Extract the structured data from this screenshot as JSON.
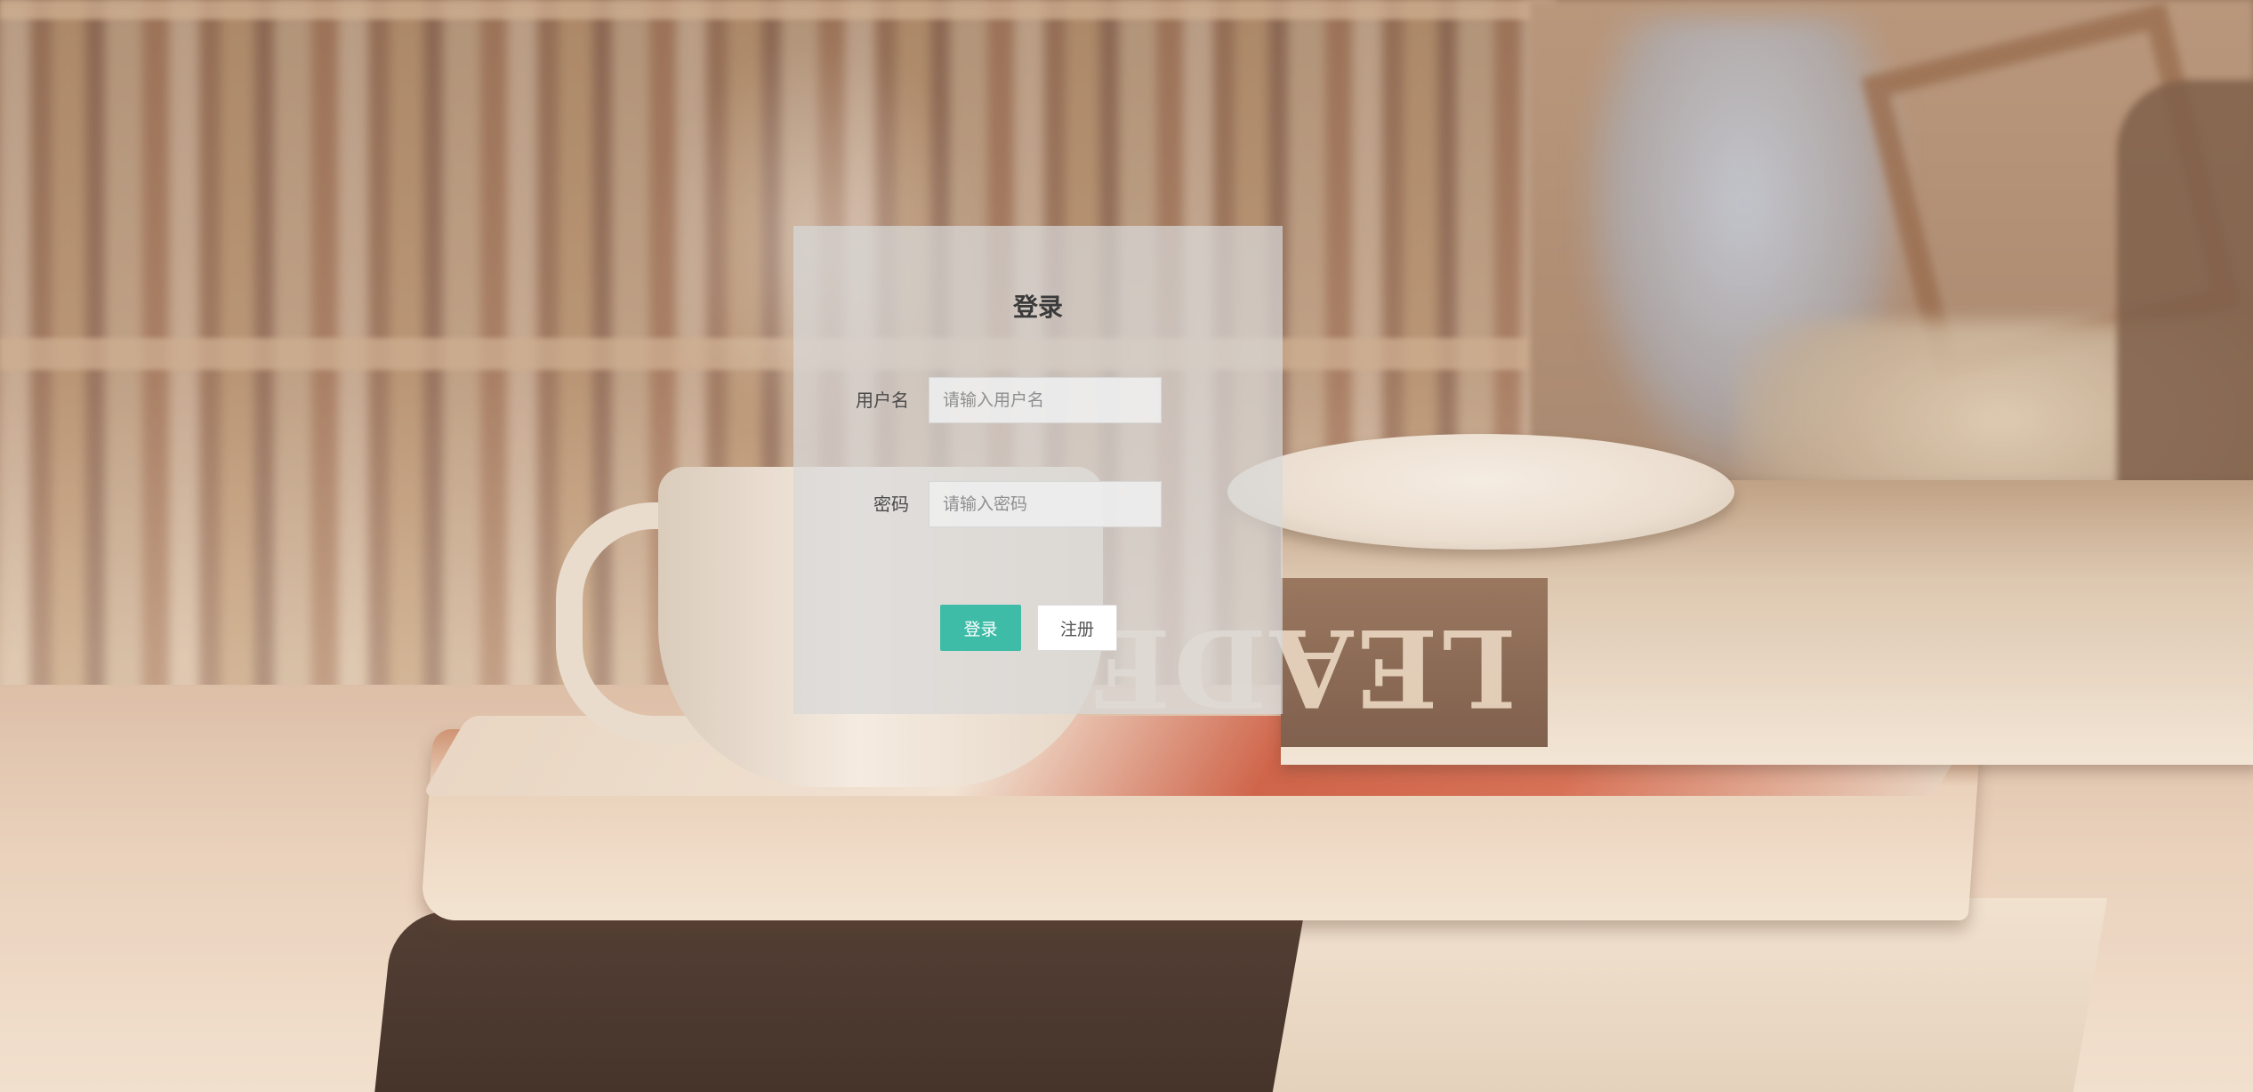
{
  "login": {
    "title": "登录",
    "username_label": "用户名",
    "username_placeholder": "请输入用户名",
    "username_value": "",
    "password_label": "密码",
    "password_placeholder": "请输入密码",
    "password_value": "",
    "login_button": "登录",
    "register_button": "注册"
  },
  "background": {
    "book_spine_text": "LEADERSH"
  },
  "colors": {
    "primary_button": "#3fbca8",
    "panel": "#d8d8d8"
  }
}
